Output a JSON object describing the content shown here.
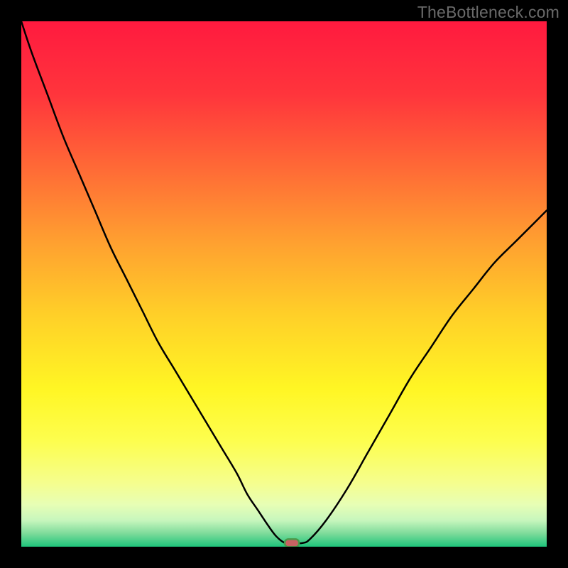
{
  "watermark": "TheBottleneck.com",
  "chart_data": {
    "type": "line",
    "title": "",
    "xlabel": "",
    "ylabel": "",
    "xlim": [
      0,
      100
    ],
    "ylim": [
      0,
      100
    ],
    "x": [
      0,
      2,
      5,
      8,
      11,
      14,
      17,
      20,
      23,
      26,
      29,
      32,
      35,
      38,
      41,
      43,
      45,
      47,
      48.5,
      50,
      51,
      53.5,
      55,
      58,
      62,
      66,
      70,
      74,
      78,
      82,
      86,
      90,
      94,
      98,
      100
    ],
    "y": [
      100,
      94,
      86,
      78,
      71,
      64,
      57,
      51,
      45,
      39,
      34,
      29,
      24,
      19,
      14,
      10,
      7,
      4,
      2,
      0.8,
      0.7,
      0.7,
      1.5,
      5,
      11,
      18,
      25,
      32,
      38,
      44,
      49,
      54,
      58,
      62,
      64
    ],
    "indicator_position": {
      "x": 51.5,
      "y": 0.7
    },
    "background_gradient": {
      "stops": [
        {
          "offset": 0.0,
          "color": "#ff1a3f"
        },
        {
          "offset": 0.14,
          "color": "#ff353c"
        },
        {
          "offset": 0.28,
          "color": "#ff6a36"
        },
        {
          "offset": 0.42,
          "color": "#ffa030"
        },
        {
          "offset": 0.56,
          "color": "#ffd028"
        },
        {
          "offset": 0.7,
          "color": "#fff624"
        },
        {
          "offset": 0.8,
          "color": "#fdfe4f"
        },
        {
          "offset": 0.88,
          "color": "#f5fe8f"
        },
        {
          "offset": 0.92,
          "color": "#e7feb5"
        },
        {
          "offset": 0.95,
          "color": "#c7f6bd"
        },
        {
          "offset": 0.975,
          "color": "#7ddb9a"
        },
        {
          "offset": 1.0,
          "color": "#1ec47b"
        }
      ]
    }
  }
}
